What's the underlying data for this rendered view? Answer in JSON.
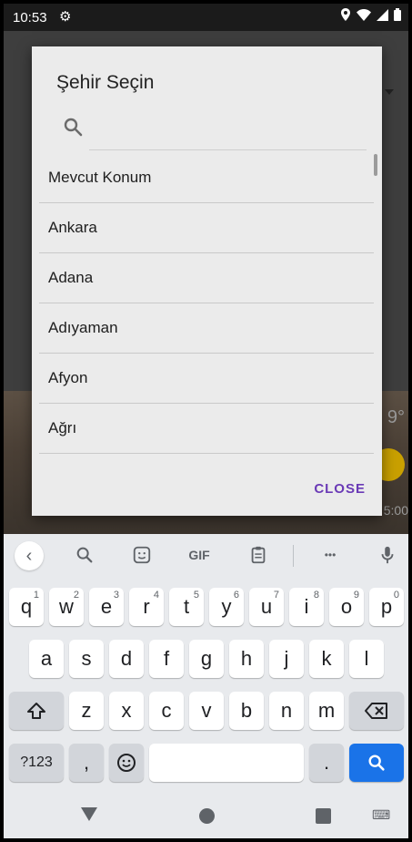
{
  "status": {
    "time": "10:53",
    "icons": [
      "gear-icon",
      "location-icon",
      "wifi-icon",
      "signal-icon",
      "battery-icon"
    ]
  },
  "background": {
    "temp": "9°",
    "time": "5:00"
  },
  "dialog": {
    "title": "Şehir Seçin",
    "search_placeholder": "",
    "items": [
      "Mevcut Konum",
      "Ankara",
      "Adana",
      "Adıyaman",
      "Afyon",
      "Ağrı"
    ],
    "close_label": "CLOSE"
  },
  "keyboard": {
    "toolbar": {
      "gif": "GIF",
      "more": "•••"
    },
    "row1": [
      [
        "q",
        "1"
      ],
      [
        "w",
        "2"
      ],
      [
        "e",
        "3"
      ],
      [
        "r",
        "4"
      ],
      [
        "t",
        "5"
      ],
      [
        "y",
        "6"
      ],
      [
        "u",
        "7"
      ],
      [
        "i",
        "8"
      ],
      [
        "o",
        "9"
      ],
      [
        "p",
        "0"
      ]
    ],
    "row2": [
      "a",
      "s",
      "d",
      "f",
      "g",
      "h",
      "j",
      "k",
      "l"
    ],
    "row3": [
      "z",
      "x",
      "c",
      "v",
      "b",
      "n",
      "m"
    ],
    "numbers_label": "?123",
    "comma": ",",
    "period": "."
  },
  "colors": {
    "accent": "#6a3ab6",
    "enter": "#1a73e8"
  }
}
